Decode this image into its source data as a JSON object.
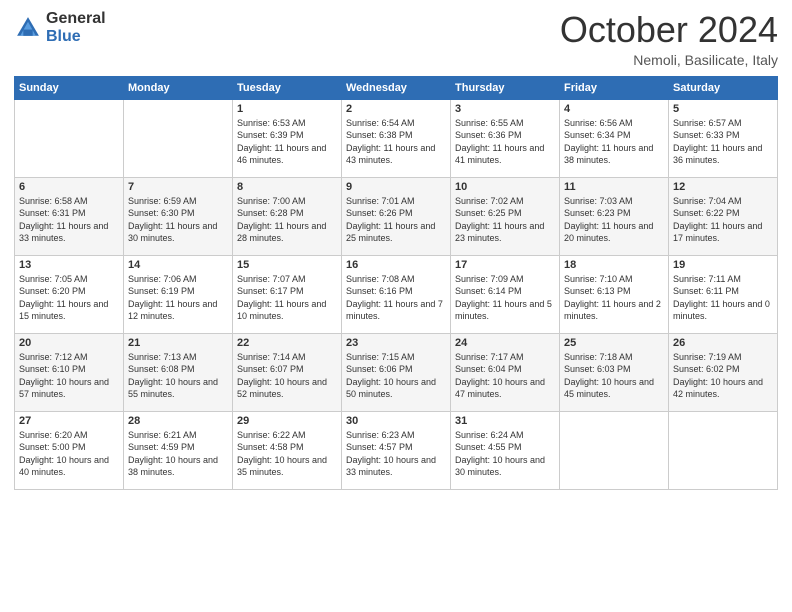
{
  "logo": {
    "general": "General",
    "blue": "Blue"
  },
  "title": {
    "month": "October 2024",
    "location": "Nemoli, Basilicate, Italy"
  },
  "days_of_week": [
    "Sunday",
    "Monday",
    "Tuesday",
    "Wednesday",
    "Thursday",
    "Friday",
    "Saturday"
  ],
  "weeks": [
    [
      {
        "day": "",
        "sunrise": "",
        "sunset": "",
        "daylight": ""
      },
      {
        "day": "",
        "sunrise": "",
        "sunset": "",
        "daylight": ""
      },
      {
        "day": "1",
        "sunrise": "Sunrise: 6:53 AM",
        "sunset": "Sunset: 6:39 PM",
        "daylight": "Daylight: 11 hours and 46 minutes."
      },
      {
        "day": "2",
        "sunrise": "Sunrise: 6:54 AM",
        "sunset": "Sunset: 6:38 PM",
        "daylight": "Daylight: 11 hours and 43 minutes."
      },
      {
        "day": "3",
        "sunrise": "Sunrise: 6:55 AM",
        "sunset": "Sunset: 6:36 PM",
        "daylight": "Daylight: 11 hours and 41 minutes."
      },
      {
        "day": "4",
        "sunrise": "Sunrise: 6:56 AM",
        "sunset": "Sunset: 6:34 PM",
        "daylight": "Daylight: 11 hours and 38 minutes."
      },
      {
        "day": "5",
        "sunrise": "Sunrise: 6:57 AM",
        "sunset": "Sunset: 6:33 PM",
        "daylight": "Daylight: 11 hours and 36 minutes."
      }
    ],
    [
      {
        "day": "6",
        "sunrise": "Sunrise: 6:58 AM",
        "sunset": "Sunset: 6:31 PM",
        "daylight": "Daylight: 11 hours and 33 minutes."
      },
      {
        "day": "7",
        "sunrise": "Sunrise: 6:59 AM",
        "sunset": "Sunset: 6:30 PM",
        "daylight": "Daylight: 11 hours and 30 minutes."
      },
      {
        "day": "8",
        "sunrise": "Sunrise: 7:00 AM",
        "sunset": "Sunset: 6:28 PM",
        "daylight": "Daylight: 11 hours and 28 minutes."
      },
      {
        "day": "9",
        "sunrise": "Sunrise: 7:01 AM",
        "sunset": "Sunset: 6:26 PM",
        "daylight": "Daylight: 11 hours and 25 minutes."
      },
      {
        "day": "10",
        "sunrise": "Sunrise: 7:02 AM",
        "sunset": "Sunset: 6:25 PM",
        "daylight": "Daylight: 11 hours and 23 minutes."
      },
      {
        "day": "11",
        "sunrise": "Sunrise: 7:03 AM",
        "sunset": "Sunset: 6:23 PM",
        "daylight": "Daylight: 11 hours and 20 minutes."
      },
      {
        "day": "12",
        "sunrise": "Sunrise: 7:04 AM",
        "sunset": "Sunset: 6:22 PM",
        "daylight": "Daylight: 11 hours and 17 minutes."
      }
    ],
    [
      {
        "day": "13",
        "sunrise": "Sunrise: 7:05 AM",
        "sunset": "Sunset: 6:20 PM",
        "daylight": "Daylight: 11 hours and 15 minutes."
      },
      {
        "day": "14",
        "sunrise": "Sunrise: 7:06 AM",
        "sunset": "Sunset: 6:19 PM",
        "daylight": "Daylight: 11 hours and 12 minutes."
      },
      {
        "day": "15",
        "sunrise": "Sunrise: 7:07 AM",
        "sunset": "Sunset: 6:17 PM",
        "daylight": "Daylight: 11 hours and 10 minutes."
      },
      {
        "day": "16",
        "sunrise": "Sunrise: 7:08 AM",
        "sunset": "Sunset: 6:16 PM",
        "daylight": "Daylight: 11 hours and 7 minutes."
      },
      {
        "day": "17",
        "sunrise": "Sunrise: 7:09 AM",
        "sunset": "Sunset: 6:14 PM",
        "daylight": "Daylight: 11 hours and 5 minutes."
      },
      {
        "day": "18",
        "sunrise": "Sunrise: 7:10 AM",
        "sunset": "Sunset: 6:13 PM",
        "daylight": "Daylight: 11 hours and 2 minutes."
      },
      {
        "day": "19",
        "sunrise": "Sunrise: 7:11 AM",
        "sunset": "Sunset: 6:11 PM",
        "daylight": "Daylight: 11 hours and 0 minutes."
      }
    ],
    [
      {
        "day": "20",
        "sunrise": "Sunrise: 7:12 AM",
        "sunset": "Sunset: 6:10 PM",
        "daylight": "Daylight: 10 hours and 57 minutes."
      },
      {
        "day": "21",
        "sunrise": "Sunrise: 7:13 AM",
        "sunset": "Sunset: 6:08 PM",
        "daylight": "Daylight: 10 hours and 55 minutes."
      },
      {
        "day": "22",
        "sunrise": "Sunrise: 7:14 AM",
        "sunset": "Sunset: 6:07 PM",
        "daylight": "Daylight: 10 hours and 52 minutes."
      },
      {
        "day": "23",
        "sunrise": "Sunrise: 7:15 AM",
        "sunset": "Sunset: 6:06 PM",
        "daylight": "Daylight: 10 hours and 50 minutes."
      },
      {
        "day": "24",
        "sunrise": "Sunrise: 7:17 AM",
        "sunset": "Sunset: 6:04 PM",
        "daylight": "Daylight: 10 hours and 47 minutes."
      },
      {
        "day": "25",
        "sunrise": "Sunrise: 7:18 AM",
        "sunset": "Sunset: 6:03 PM",
        "daylight": "Daylight: 10 hours and 45 minutes."
      },
      {
        "day": "26",
        "sunrise": "Sunrise: 7:19 AM",
        "sunset": "Sunset: 6:02 PM",
        "daylight": "Daylight: 10 hours and 42 minutes."
      }
    ],
    [
      {
        "day": "27",
        "sunrise": "Sunrise: 6:20 AM",
        "sunset": "Sunset: 5:00 PM",
        "daylight": "Daylight: 10 hours and 40 minutes."
      },
      {
        "day": "28",
        "sunrise": "Sunrise: 6:21 AM",
        "sunset": "Sunset: 4:59 PM",
        "daylight": "Daylight: 10 hours and 38 minutes."
      },
      {
        "day": "29",
        "sunrise": "Sunrise: 6:22 AM",
        "sunset": "Sunset: 4:58 PM",
        "daylight": "Daylight: 10 hours and 35 minutes."
      },
      {
        "day": "30",
        "sunrise": "Sunrise: 6:23 AM",
        "sunset": "Sunset: 4:57 PM",
        "daylight": "Daylight: 10 hours and 33 minutes."
      },
      {
        "day": "31",
        "sunrise": "Sunrise: 6:24 AM",
        "sunset": "Sunset: 4:55 PM",
        "daylight": "Daylight: 10 hours and 30 minutes."
      },
      {
        "day": "",
        "sunrise": "",
        "sunset": "",
        "daylight": ""
      },
      {
        "day": "",
        "sunrise": "",
        "sunset": "",
        "daylight": ""
      }
    ]
  ]
}
